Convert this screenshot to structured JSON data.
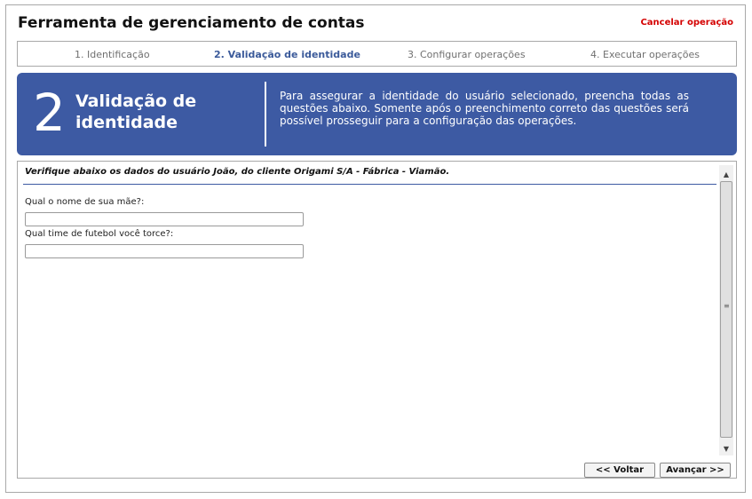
{
  "window": {
    "title": "Ferramenta de gerenciamento de contas",
    "cancel_label": "Cancelar operação"
  },
  "steps": [
    {
      "label": "1. Identificação",
      "active": false
    },
    {
      "label": "2. Validação de identidade",
      "active": true
    },
    {
      "label": "3. Configurar operações",
      "active": false
    },
    {
      "label": "4. Executar operações",
      "active": false
    }
  ],
  "banner": {
    "number": "2",
    "heading_line1": "Validação de",
    "heading_line2": "identidade",
    "description": "Para assegurar a identidade do usuário selecionado, preencha todas as questões abaixo. Somente após o preenchimento correto das questões será possível prosseguir para a configuração das operações."
  },
  "form": {
    "verify_text": "Verifique abaixo os dados do usuário João, do cliente Origami S/A - Fábrica - Viamão.",
    "questions": [
      {
        "label": "Qual o nome de sua mãe?:",
        "value": "",
        "placeholder": ""
      },
      {
        "label": "Qual time de futebol você torce?:",
        "value": "",
        "placeholder": ""
      }
    ]
  },
  "buttons": {
    "back_label": "<< Voltar",
    "next_label": "Avançar >>"
  },
  "icons": {
    "scroll_up": "scroll-up-icon",
    "scroll_down": "scroll-down-icon",
    "grip": "scroll-grip-icon"
  },
  "colors": {
    "banner_bg": "#3d5aa3",
    "active_step": "#3b5a9a",
    "cancel": "#d40000"
  }
}
